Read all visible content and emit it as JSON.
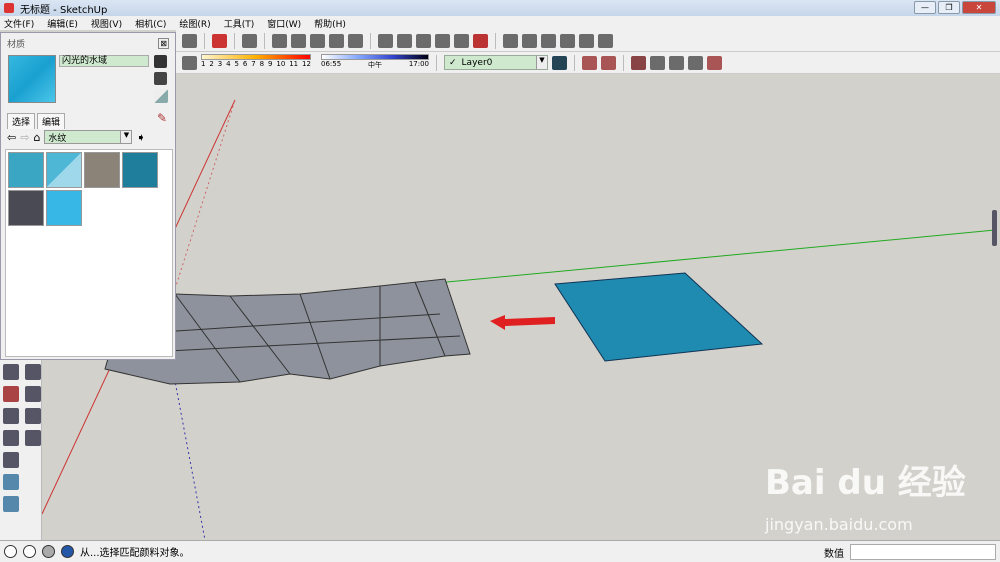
{
  "window": {
    "title": "无标题 - SketchUp",
    "min": "—",
    "max": "❐",
    "close": "✕"
  },
  "menu": [
    "文件(F)",
    "编辑(E)",
    "视图(V)",
    "相机(C)",
    "绘图(R)",
    "工具(T)",
    "窗口(W)",
    "帮助(H)"
  ],
  "shadow": {
    "month_labels": [
      "1",
      "2",
      "3",
      "4",
      "5",
      "6",
      "7",
      "8",
      "9",
      "10",
      "11",
      "12"
    ],
    "time_start": "06:55",
    "time_mid": "中午",
    "time_end": "17:00"
  },
  "layer": {
    "checked": "✓",
    "name": "Layer0"
  },
  "materials": {
    "title": "材质",
    "close": "⊠",
    "name": "闪光的水域",
    "tabs": [
      "选择",
      "编辑"
    ],
    "collection": "水纹",
    "swatches": [
      "#3aa6c4",
      "#4fb7d6",
      "#8b8378",
      "#1f7e9c",
      "#4a4a55",
      "#36b7e6"
    ]
  },
  "status": {
    "message": "从...选择匹配颜料对象。",
    "value_label": "数值",
    "value": ""
  },
  "watermark": {
    "brand": "Bai du 经验",
    "url": "jingyan.baidu.com"
  },
  "colors": {
    "accent_water": "#2a8fb0",
    "arrow": "#e02020"
  }
}
